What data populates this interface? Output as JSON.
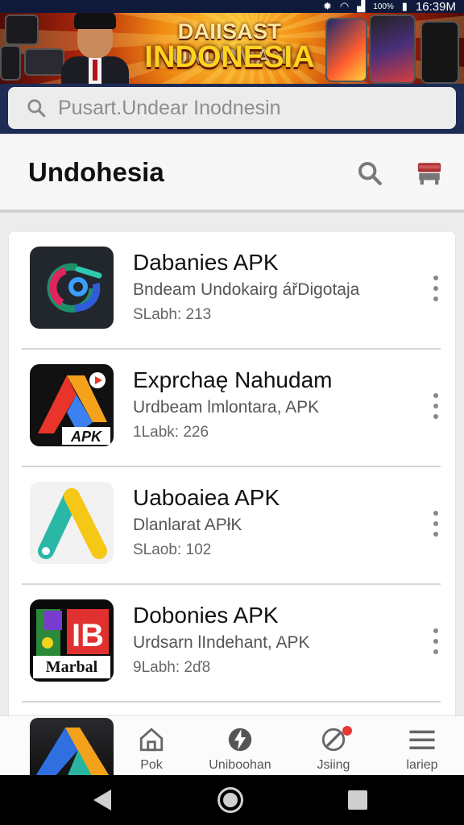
{
  "status_bar": {
    "battery": "100%",
    "time": "16:39M"
  },
  "banner": {
    "title_line1": "DAIISAST UNDOMAN",
    "title_line2": "INDONESIA"
  },
  "search": {
    "placeholder": "Pusart.Undear Inodnesin"
  },
  "header": {
    "title": "Undohesia"
  },
  "apps": [
    {
      "name": "Dabanies APK",
      "subtitle": "Bndeam Undokairg ářDigotaja",
      "meta": "SLabh: 213"
    },
    {
      "name": "Exprchaę Nahudam",
      "subtitle": "Urdbeam lmlontara, APK",
      "meta": "1Labk: 226",
      "icon_label": "APK"
    },
    {
      "name": "Uaboaiea APK",
      "subtitle": "Dlanlarat APłK",
      "meta": "SLaob: 102"
    },
    {
      "name": "Dobonies APK",
      "subtitle": "Urdsarn lIndehant, APK",
      "meta": "9Labh: 2ď8",
      "icon_label": "Marbal"
    }
  ],
  "bottom_nav": [
    {
      "label": "Pok",
      "icon": "home-icon"
    },
    {
      "label": "Uniboohan",
      "icon": "bolt-icon"
    },
    {
      "label": "Jsiing",
      "icon": "edit-icon"
    },
    {
      "label": "lariep",
      "icon": "menu-icon"
    }
  ],
  "colors": {
    "banner_bg": "#f08a12",
    "search_bar_bg": "#1d2c55",
    "badge": "#e53935"
  }
}
